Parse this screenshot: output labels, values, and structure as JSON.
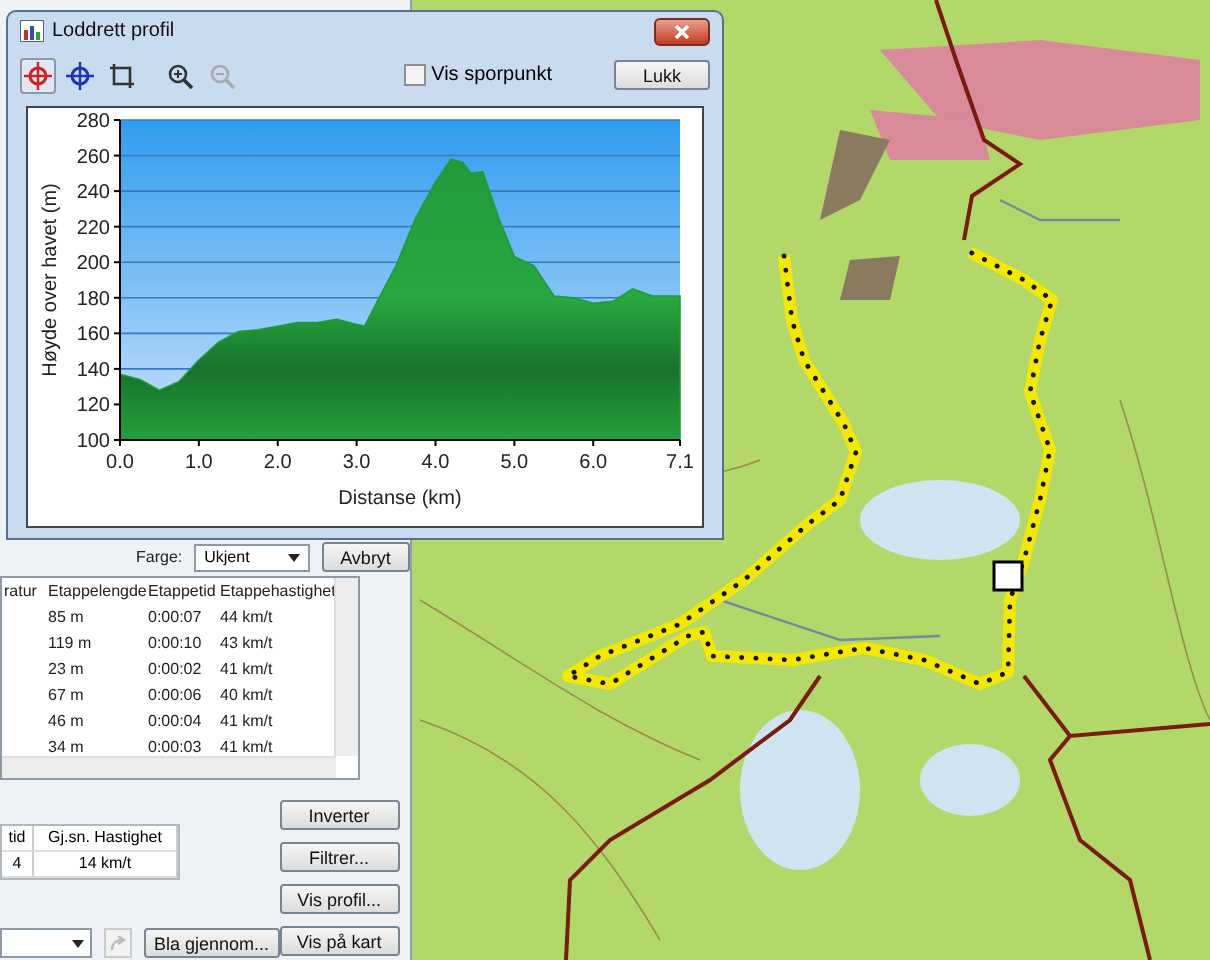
{
  "dialog": {
    "title": "Loddrett profil",
    "tools": [
      {
        "kind": "crosshair-red",
        "selected": true,
        "disabled": false
      },
      {
        "kind": "crosshair-blue",
        "selected": false,
        "disabled": false
      },
      {
        "kind": "crop",
        "selected": false,
        "disabled": false
      },
      {
        "kind": "zoom-in",
        "selected": false,
        "disabled": false
      },
      {
        "kind": "zoom-out",
        "selected": false,
        "disabled": true
      }
    ],
    "checkbox": {
      "label": "Vis sporpunkt",
      "checked": false
    },
    "close_button": "Lukk",
    "chart_data": {
      "type": "area",
      "grid": true,
      "xlabel": "Distanse (km)",
      "ylabel": "Høyde over havet (m)",
      "xlim": [
        0,
        7.1
      ],
      "ylim": [
        100,
        280
      ],
      "xticks": [
        {
          "value": 0,
          "label": "0.0"
        },
        {
          "value": 1,
          "label": "1.0"
        },
        {
          "value": 2,
          "label": "2.0"
        },
        {
          "value": 3,
          "label": "3.0"
        },
        {
          "value": 4,
          "label": "4.0"
        },
        {
          "value": 5,
          "label": "5.0"
        },
        {
          "value": 6,
          "label": "6.0"
        },
        {
          "value": 7.1,
          "label": "7.1"
        }
      ],
      "yticks": [
        100,
        120,
        140,
        160,
        180,
        200,
        220,
        240,
        260,
        280
      ],
      "x": [
        0,
        0.25,
        0.5,
        0.75,
        1,
        1.25,
        1.5,
        1.75,
        2,
        2.25,
        2.5,
        2.75,
        3,
        3.1,
        3.25,
        3.5,
        3.75,
        4,
        4.2,
        4.35,
        4.45,
        4.6,
        4.8,
        5,
        5.25,
        5.5,
        5.75,
        6,
        6.25,
        6.5,
        6.75,
        7.1
      ],
      "series": [
        {
          "color": "#1f9a3a",
          "values": [
            137,
            134,
            128,
            133,
            145,
            155,
            161,
            162,
            164,
            166,
            166,
            168,
            165,
            164,
            177,
            198,
            225,
            245,
            258,
            256,
            250,
            251,
            225,
            203,
            198,
            181,
            180,
            177,
            178,
            185,
            181,
            181
          ]
        }
      ]
    }
  },
  "track_window": {
    "color_label": "Farge:",
    "color_select": "Ukjent",
    "cancel_button": "Avbryt",
    "table": {
      "columns": [
        "ratur",
        "Etappelengde",
        "Etappetid",
        "Etappehastighet"
      ],
      "rows": [
        [
          "",
          "85 m",
          "0:00:07",
          "44 km/t"
        ],
        [
          "",
          "119 m",
          "0:00:10",
          "43 km/t"
        ],
        [
          "",
          "23 m",
          "0:00:02",
          "41 km/t"
        ],
        [
          "",
          "67 m",
          "0:00:06",
          "40 km/t"
        ],
        [
          "",
          "46 m",
          "0:00:04",
          "41 km/t"
        ],
        [
          "",
          "34 m",
          "0:00:03",
          "41 km/t"
        ]
      ]
    },
    "summary": {
      "columns": [
        "tid",
        "Gj.sn. Hastighet"
      ],
      "rows": [
        [
          "4",
          "14 km/t"
        ]
      ]
    },
    "browse_button": "Bla gjennom...",
    "buttons": [
      "Inverter",
      "Filtrer...",
      "Vis profil...",
      "Vis på kart"
    ]
  }
}
